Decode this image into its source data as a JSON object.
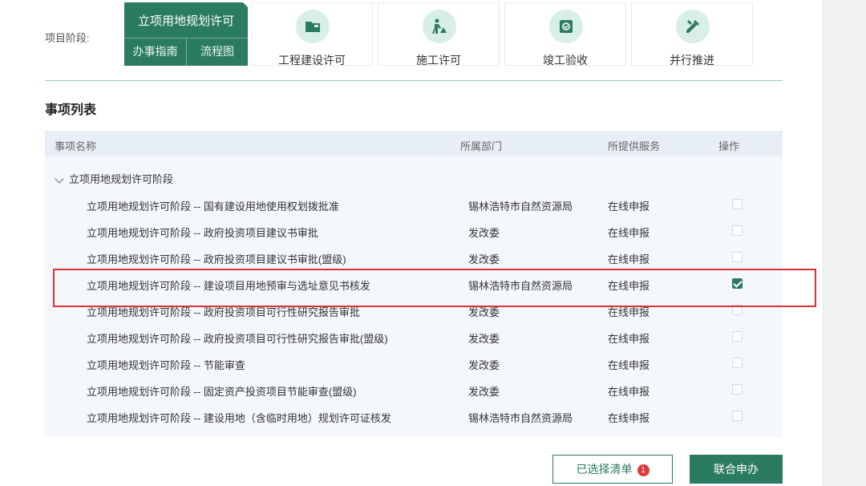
{
  "stage_label": "项目阶段:",
  "active_stage": {
    "title": "立项用地规划许可",
    "sub_tabs": [
      "办事指南",
      "流程图"
    ]
  },
  "stages": [
    {
      "label": "工程建设许可",
      "icon": "folder-icon"
    },
    {
      "label": "施工许可",
      "icon": "construction-worker-icon"
    },
    {
      "label": "竣工验收",
      "icon": "inspection-box-icon"
    },
    {
      "label": "并行推进",
      "icon": "ruler-pencil-icon"
    }
  ],
  "section_title": "事项列表",
  "table": {
    "headers": [
      "事项名称",
      "所属部门",
      "所提供服务",
      "操作"
    ],
    "group": "立项用地规划许可阶段",
    "rows": [
      {
        "name": "立项用地规划许可阶段 -- 国有建设用地使用权划拨批准",
        "dept": "锡林浩特市自然资源局",
        "service": "在线申报",
        "checked": false
      },
      {
        "name": "立项用地规划许可阶段 -- 政府投资项目建议书审批",
        "dept": "发改委",
        "service": "在线申报",
        "checked": false
      },
      {
        "name": "立项用地规划许可阶段 -- 政府投资项目建议书审批(盟级)",
        "dept": "发改委",
        "service": "在线申报",
        "checked": false
      },
      {
        "name": "立项用地规划许可阶段 -- 建设项目用地预审与选址意见书核发",
        "dept": "锡林浩特市自然资源局",
        "service": "在线申报",
        "checked": true
      },
      {
        "name": "立项用地规划许可阶段 -- 政府投资项目可行性研究报告审批",
        "dept": "发改委",
        "service": "在线申报",
        "checked": false
      },
      {
        "name": "立项用地规划许可阶段 -- 政府投资项目可行性研究报告审批(盟级)",
        "dept": "发改委",
        "service": "在线申报",
        "checked": false
      },
      {
        "name": "立项用地规划许可阶段 -- 节能审查",
        "dept": "发改委",
        "service": "在线申报",
        "checked": false
      },
      {
        "name": "立项用地规划许可阶段 -- 固定资产投资项目节能审查(盟级)",
        "dept": "发改委",
        "service": "在线申报",
        "checked": false
      },
      {
        "name": "立项用地规划许可阶段 -- 建设用地（含临时用地）规划许可证核发",
        "dept": "锡林浩特市自然资源局",
        "service": "在线申报",
        "checked": false
      }
    ]
  },
  "buttons": {
    "selected_list": "已选择清单",
    "selected_count": "1",
    "joint_apply": "联合申办"
  },
  "colors": {
    "primary": "#2b7b63",
    "highlight_border": "#d9323a",
    "badge": "#e03a3a"
  }
}
